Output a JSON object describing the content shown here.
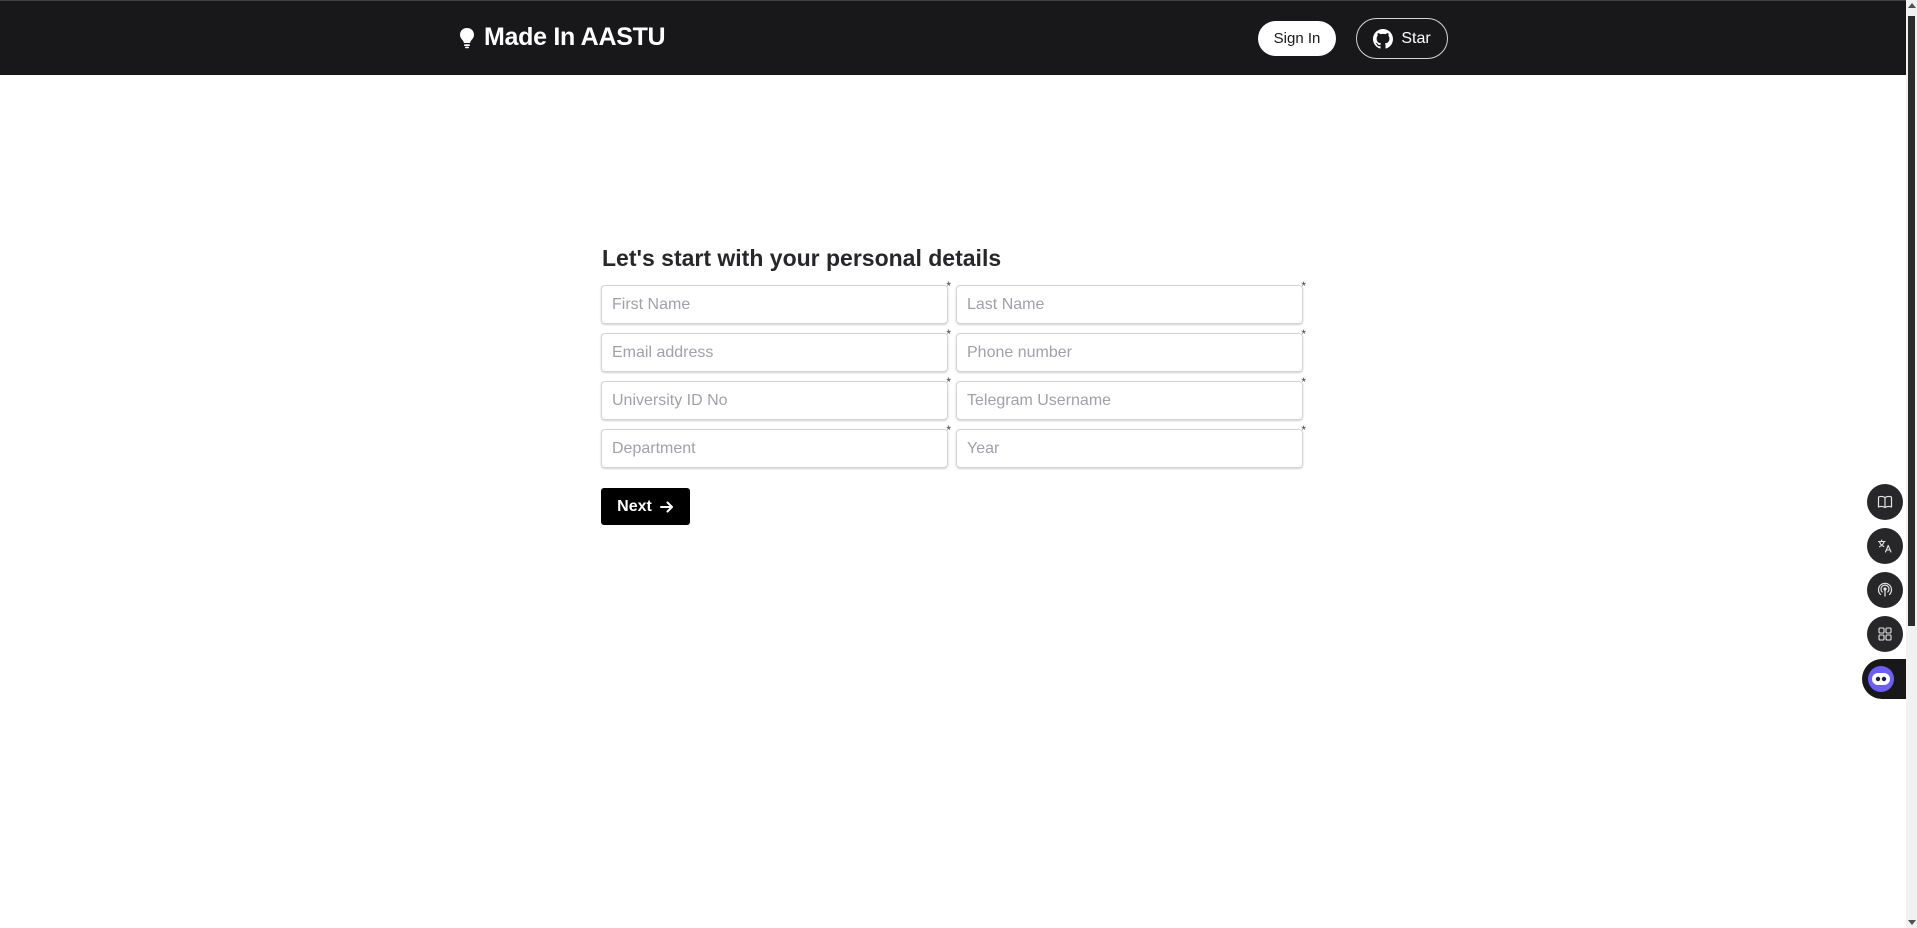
{
  "header": {
    "brand": "Made In AASTU",
    "signin_label": "Sign In",
    "star_label": "Star"
  },
  "form": {
    "title": "Let's start with your personal details",
    "fields": {
      "first_name": "First Name",
      "last_name": "Last Name",
      "email": "Email address",
      "phone": "Phone number",
      "university_id": "University ID No",
      "telegram": "Telegram Username",
      "department": "Department",
      "year": "Year"
    },
    "required_mark": "*",
    "next_label": "Next"
  },
  "floating_tools": [
    "book-icon",
    "translate-icon",
    "broadcast-icon",
    "apps-grid-icon",
    "assistant-bot-icon"
  ]
}
